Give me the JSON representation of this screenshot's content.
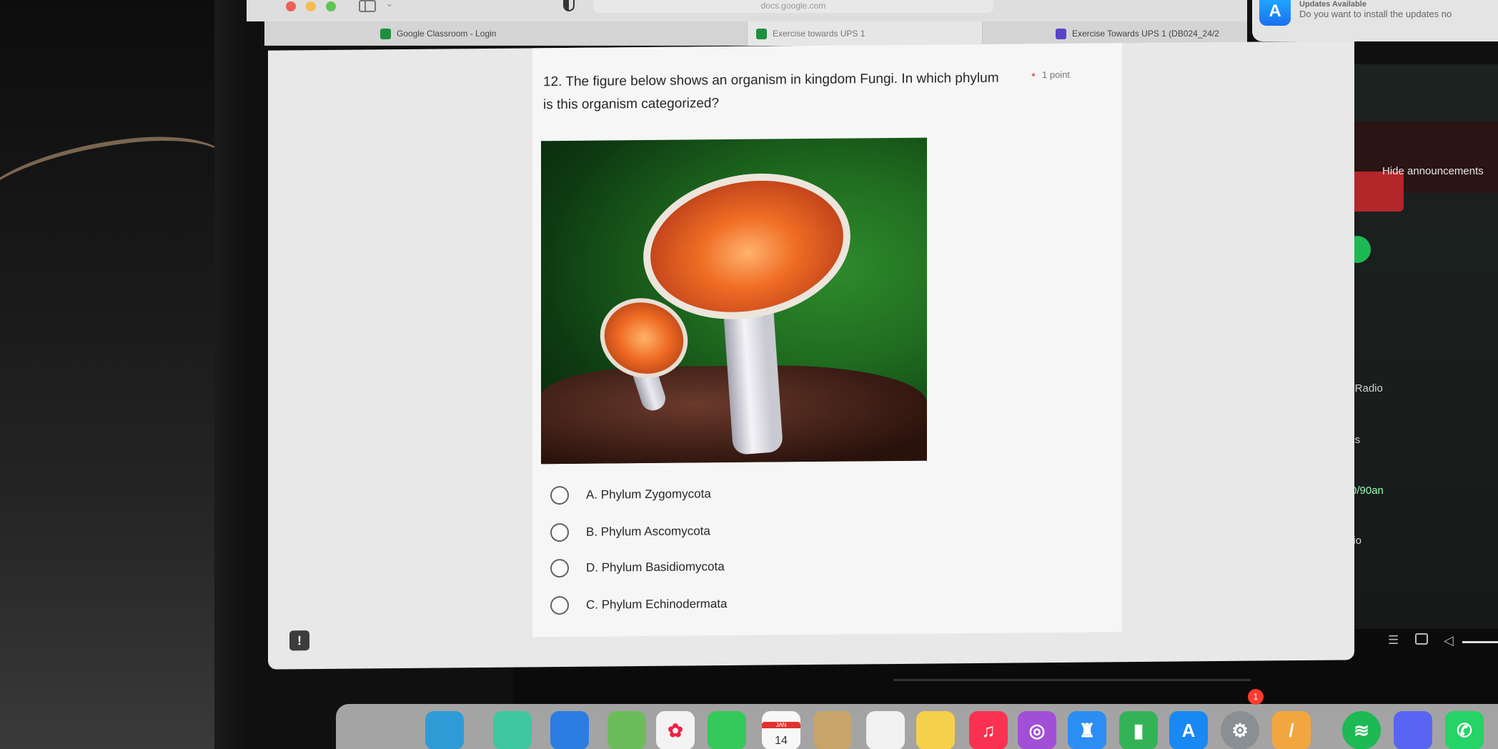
{
  "browser": {
    "address": "docs.google.com",
    "tabs": [
      {
        "label": "Google Classroom - Login"
      },
      {
        "label": "Exercise towards UPS 1"
      },
      {
        "label": "Exercise Towards UPS 1 (DB024_24/2"
      }
    ]
  },
  "notification": {
    "title": "Updates Available",
    "body": "Do you want to install the updates no"
  },
  "form": {
    "question": "12. The figure below shows an organism in kingdom Fungi. In which phylum is this organism categorized?",
    "points": "1 point",
    "required_mark": "*",
    "options": [
      {
        "label": "A. Phylum Zygomycota"
      },
      {
        "label": "B. Phylum Ascomycota"
      },
      {
        "label": "D. Phylum Basidiomycota"
      },
      {
        "label": "C. Phylum Echinodermata"
      }
    ],
    "help_label": "!"
  },
  "background_app": {
    "hide_announcements": "Hide announcements",
    "texts": [
      "s Radio",
      "ies",
      "0/90an",
      "lio"
    ]
  },
  "calendar": {
    "month": "JAN",
    "day": "14"
  },
  "dock": {
    "badges": [
      "1"
    ]
  },
  "colors": {
    "required": "#d93025",
    "spotify": "#1db954",
    "classroom": "#1e8e3e",
    "forms": "#5b43c9"
  }
}
